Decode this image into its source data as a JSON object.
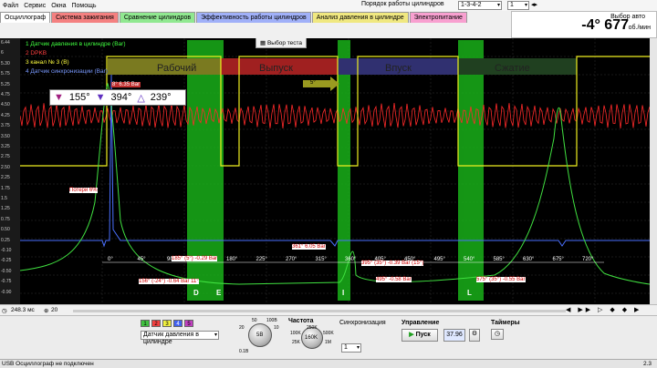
{
  "menu": [
    "Файл",
    "Сервис",
    "Окна",
    "Помощь"
  ],
  "cylinder_order": {
    "label": "Порядок работы цилиндров",
    "value": "1-3-4-2",
    "cyl": "1"
  },
  "auto_select": "Выбор авто",
  "tabs": [
    {
      "label": "Осциллограф",
      "active": true,
      "color": "#ffffff"
    },
    {
      "label": "Система зажигания",
      "color": "#f48080"
    },
    {
      "label": "Сравнение цилиндров",
      "color": "#90e890"
    },
    {
      "label": "Эффективность работы цилиндров",
      "color": "#a0b0f8"
    },
    {
      "label": "Анализ давления в цилиндре",
      "color": "#f0e880"
    },
    {
      "label": "Электропитание",
      "color": "#f8a0d0"
    }
  ],
  "angle_readout": {
    "value": "-4° 677",
    "unit": "об./мин"
  },
  "legend": [
    {
      "label": "1 Датчик давления в цилиндре (Bar)",
      "color": "#40ff40"
    },
    {
      "label": "2 DPKB",
      "color": "#ff4040"
    },
    {
      "label": "3 канал № 3 (В)",
      "color": "#ffff40"
    },
    {
      "label": "4 Датчик синхронизации (Bar)",
      "color": "#5080ff"
    }
  ],
  "test_select": "Выбор теста",
  "strokes": [
    "Рабочий",
    "Выпуск",
    "Впуск",
    "Сжатие"
  ],
  "marker_5": "5°",
  "angles_box": {
    "a1": "155°",
    "a2": "394°",
    "a3": "239°"
  },
  "yticks": [
    "6.44",
    "6",
    "5.30",
    "5.75",
    "5.25",
    "4.75",
    "4.50",
    "4.25",
    "3.75",
    "3.50",
    "3.25",
    "2.75",
    "2.50",
    "2.25",
    "1.75",
    "1.5",
    "1.25",
    "0.75",
    "0.50",
    "0.25",
    "-0.10",
    "-0.25",
    "-0.50",
    "-0.75",
    "-0.90"
  ],
  "degree_ticks": [
    "0°",
    "45°",
    "90°",
    "135°",
    "180°",
    "225°",
    "270°",
    "315°",
    "360°",
    "405°",
    "450°",
    "495°",
    "540°",
    "585°",
    "630°",
    "675°",
    "720°"
  ],
  "annotations": {
    "peak_left": "8° 6.35 Bar",
    "loss": "Потери 6%",
    "a361": "361° 6.05 Bar",
    "a185": "185° (5°) -0.29 Bar",
    "a156": "156° (-24°) -0.64 Bar 11°",
    "a395": "395° (35°) -0.39 Bar (15°)",
    "a495": "495° -0.58 Bar",
    "a575": "575° (35°) -0.55 Bar"
  },
  "band_labels": [
    "D",
    "E",
    "I",
    "L"
  ],
  "timebase": "248.3 мс",
  "zoom": "20",
  "bottom": {
    "channel_nums": [
      "1",
      "2",
      "3",
      "4",
      "5"
    ],
    "channel_select": "Датчик давления в цилиндре",
    "range_labels": [
      "50",
      "100В",
      "20",
      "10",
      "5В",
      "0.1В",
      "0",
      "5В"
    ],
    "freq_title": "Частота",
    "freq_labels": [
      "250K",
      "100K",
      "500K",
      "1M",
      "25K",
      "160K"
    ],
    "sync_title": "Синхронизация",
    "sync_val": "1",
    "ctrl_title": "Управление",
    "start": "Пуск",
    "value": "37.96",
    "timers_title": "Таймеры"
  },
  "status": {
    "left": "USB Осциллограф не подключен",
    "right": "2.3"
  }
}
